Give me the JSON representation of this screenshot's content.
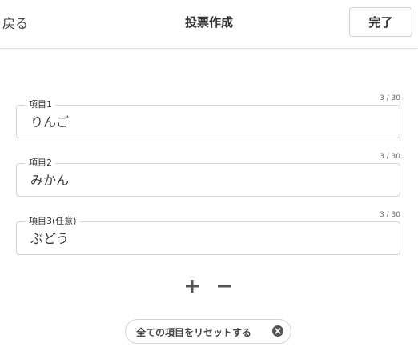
{
  "header": {
    "back_label": "戻る",
    "title": "投票作成",
    "done_label": "完了"
  },
  "fields": [
    {
      "label": "項目1",
      "value": "りんご",
      "counter": "3 / 30"
    },
    {
      "label": "項目2",
      "value": "みかん",
      "counter": "3 / 30"
    },
    {
      "label": "項目3(任意)",
      "value": "ぶどう",
      "counter": "3 / 30"
    }
  ],
  "controls": {
    "add_icon": "plus-icon",
    "remove_icon": "minus-icon"
  },
  "reset": {
    "label": "全ての項目をリセットする",
    "icon": "close-circle-icon"
  },
  "colors": {
    "text": "#333333",
    "border": "#d3d3d3",
    "icon": "#555555"
  }
}
